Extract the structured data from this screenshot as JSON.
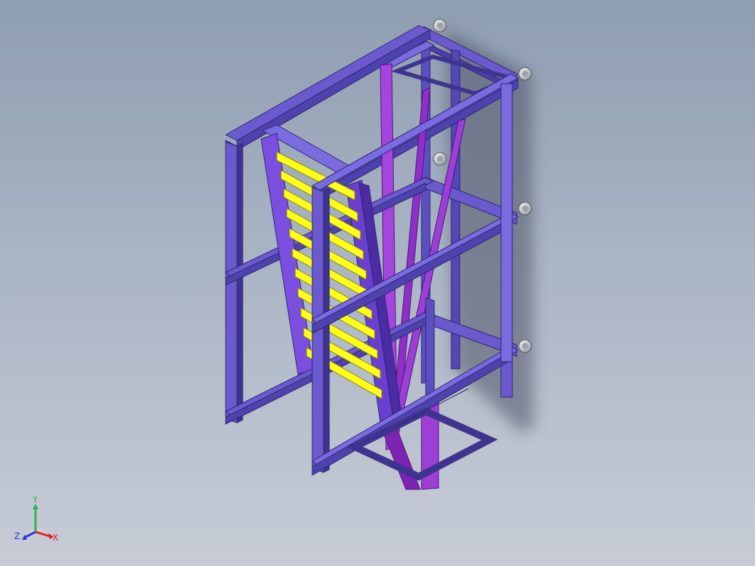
{
  "scene": {
    "description_hidden": "",
    "colors": {
      "background_top": "#8f9db1",
      "background_bottom": "#c7ccd6",
      "frame_profile": "#6a5acd",
      "frame_profile_dark": "#3e348f",
      "frame_profile_light": "#8b7fe6",
      "brace_purple": "#9b3fd6",
      "brace_purple_dark": "#6c22a0",
      "roller_yellow": "#ffff1a",
      "roller_yellow_dark": "#c8c800",
      "shadow": "#5b6272",
      "foot_metal": "#d9dde3"
    }
  },
  "triad": {
    "x_label": "X",
    "y_label": "Y",
    "z_label": "Z",
    "x_color": "#e0201b",
    "y_color": "#2fb24a",
    "z_color": "#2438d8"
  }
}
